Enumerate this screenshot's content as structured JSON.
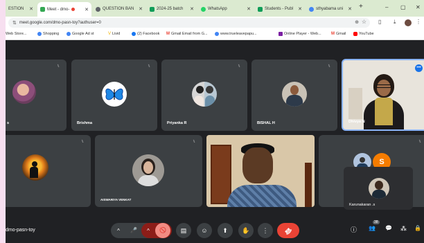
{
  "tabs": [
    {
      "label": "ESTION",
      "color": "#e8eaed"
    },
    {
      "label": "Meet - dmo-",
      "color": "#34a853"
    },
    {
      "label": "QUESTION BAN",
      "color": "#5f6368"
    },
    {
      "label": "2024-25 batch",
      "color": "#0f9d58"
    },
    {
      "label": "WhatsApp",
      "color": "#25d366"
    },
    {
      "label": "Students - Publ",
      "color": "#0f9d58"
    },
    {
      "label": "sthyabama uni",
      "color": "#4285f4"
    }
  ],
  "window": {
    "minimize": "–",
    "maximize": "▢",
    "close": "✕",
    "new_tab": "+",
    "tab_close": "✕"
  },
  "address": {
    "url": "meet.google.com/dmo-pasn-toy?authuser=0"
  },
  "bookmarks": [
    {
      "label": "Web Store...",
      "color": "#4285f4"
    },
    {
      "label": "Shopping",
      "color": "#4285f4"
    },
    {
      "label": "Google Ad st",
      "color": "#4285f4"
    },
    {
      "label": "Livid",
      "color": "#f4b400"
    },
    {
      "label": "(2) Facebook",
      "color": "#1877f2"
    },
    {
      "label": "Gmail Email from G...",
      "color": "#ea4335"
    },
    {
      "label": "www.trueleavepapu...",
      "color": "#4285f4"
    },
    {
      "label": "Online Player - Web...",
      "color": "#7b1fa2"
    },
    {
      "label": "Gmail",
      "color": "#ea4335"
    },
    {
      "label": "YouTube",
      "color": "#ff0000"
    }
  ],
  "participants": {
    "p1": {
      "name": "s"
    },
    "p2": {
      "name": "Brishma"
    },
    "p3": {
      "name": "Priyanka R"
    },
    "p4": {
      "name": "BISHAL H"
    },
    "p5": {
      "name": "Dhivya N"
    },
    "p7": {
      "name": "AISWARIYA VENKAT"
    },
    "p10": {
      "name": "Karunakaran .s",
      "initial": "S"
    }
  },
  "meeting": {
    "code": "dmo-pasn-toy",
    "participant_count": "38"
  },
  "controls": {
    "up_arrow": "^",
    "mic": "🎤",
    "cam_off": "🚫",
    "captions": "▤",
    "emoji": "☺",
    "present": "⬆",
    "raise_hand": "✋",
    "more": "⋮",
    "end_call": "☎"
  },
  "right_controls": {
    "info": "ⓘ",
    "people": "👥",
    "chat": "💬",
    "activities": "⁂",
    "lock": "🔒"
  },
  "colors": {
    "end_call": "#ea4335",
    "cam_off": "#f28b82",
    "speaker_border": "#8ab4f8",
    "accent_orange": "#f57c00"
  }
}
